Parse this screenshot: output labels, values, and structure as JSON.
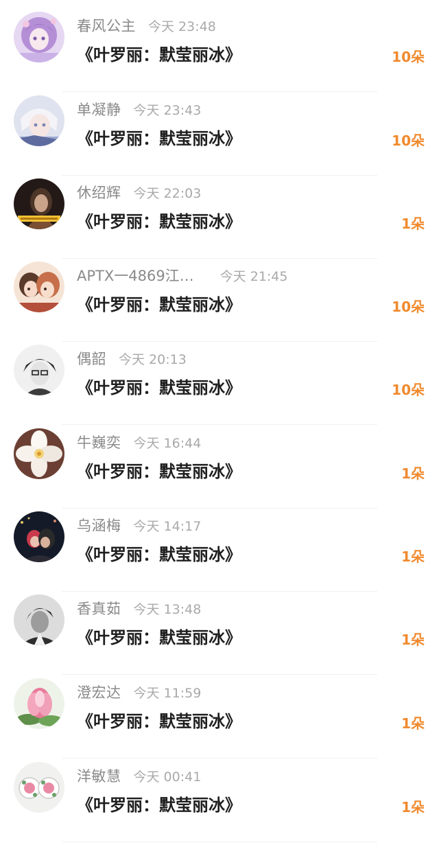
{
  "rows": [
    {
      "name": "春风公主",
      "time": "今天 23:48",
      "work": "《叶罗丽：默莹丽冰》",
      "count": "10朵",
      "avatar": "purple-hair-girl-avatar"
    },
    {
      "name": "单凝静",
      "time": "今天 23:43",
      "work": "《叶罗丽：默莹丽冰》",
      "count": "10朵",
      "avatar": "white-hair-boy-avatar"
    },
    {
      "name": "休绍辉",
      "time": "今天 22:03",
      "work": "《叶罗丽：默莹丽冰》",
      "count": "1朵",
      "avatar": "dark-hooded-person-avatar"
    },
    {
      "name": "APTX一4869江…",
      "time": "今天 21:45",
      "work": "《叶罗丽：默莹丽冰》",
      "count": "10朵",
      "avatar": "anime-couple-avatar"
    },
    {
      "name": "偶韶",
      "time": "今天 20:13",
      "work": "《叶罗丽：默莹丽冰》",
      "count": "10朵",
      "avatar": "sketch-boy-glasses-avatar"
    },
    {
      "name": "牛巍奕",
      "time": "今天 16:44",
      "work": "《叶罗丽：默莹丽冰》",
      "count": "1朵",
      "avatar": "white-flower-avatar"
    },
    {
      "name": "乌涵梅",
      "time": "今天 14:17",
      "work": "《叶罗丽：默莹丽冰》",
      "count": "1朵",
      "avatar": "night-city-couple-avatar"
    },
    {
      "name": "香真茹",
      "time": "今天 13:48",
      "work": "《叶罗丽：默莹丽冰》",
      "count": "1朵",
      "avatar": "monochrome-man-avatar"
    },
    {
      "name": "澄宏达",
      "time": "今天 11:59",
      "work": "《叶罗丽：默莹丽冰》",
      "count": "1朵",
      "avatar": "pink-lotus-avatar"
    },
    {
      "name": "洋敏慧",
      "time": "今天 00:41",
      "work": "《叶罗丽：默莹丽冰》",
      "count": "1朵",
      "avatar": "floral-earrings-avatar"
    }
  ],
  "colors": {
    "name": "#8a8a8a",
    "time": "#a9a9a9",
    "work": "#1f1f1f",
    "count": "#f08a2e"
  }
}
